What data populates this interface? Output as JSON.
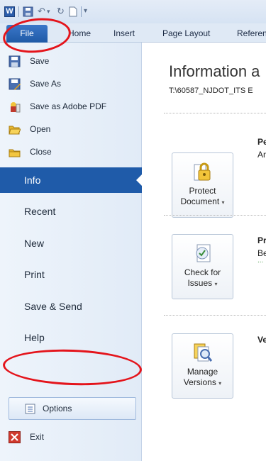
{
  "quick_access": {
    "app_icon_letter": "W",
    "save_icon": "save-icon",
    "undo_icon": "undo-icon",
    "redo_icon": "repeat-icon",
    "new_icon": "new-document-icon",
    "customize_icon": "customize-qat-icon"
  },
  "ribbon_tabs": {
    "file": "File",
    "home": "Home",
    "insert": "Insert",
    "page_layout": "Page Layout",
    "references": "Referen"
  },
  "backstage": {
    "commands": [
      {
        "label": "Save",
        "icon": "save-icon"
      },
      {
        "label": "Save As",
        "icon": "save-as-icon"
      },
      {
        "label": "Save as Adobe PDF",
        "icon": "adobe-pdf-icon"
      },
      {
        "label": "Open",
        "icon": "open-folder-icon"
      },
      {
        "label": "Close",
        "icon": "close-folder-icon"
      }
    ],
    "nav": {
      "info": "Info",
      "recent": "Recent",
      "new": "New",
      "print": "Print",
      "save_send": "Save & Send",
      "help": "Help"
    },
    "options": "Options",
    "exit": "Exit"
  },
  "info": {
    "title": "Information a",
    "path": "T:\\60587_NJDOT_ITS E",
    "sections": [
      {
        "button_line1": "Protect",
        "button_line2": "Document",
        "dropdown": "▾",
        "heading": "Pe",
        "text": "An",
        "icon": "protect-document-icon"
      },
      {
        "button_line1": "Check for",
        "button_line2": "Issues",
        "dropdown": "▾",
        "heading": "Pr",
        "text": "Be",
        "icon": "check-issues-icon"
      },
      {
        "button_line1": "Manage",
        "button_line2": "Versions",
        "dropdown": "▾",
        "heading": "Ve",
        "text": "",
        "icon": "manage-versions-icon"
      }
    ]
  },
  "colors": {
    "accent": "#1f5ba9",
    "annotation": "#e4141b"
  }
}
